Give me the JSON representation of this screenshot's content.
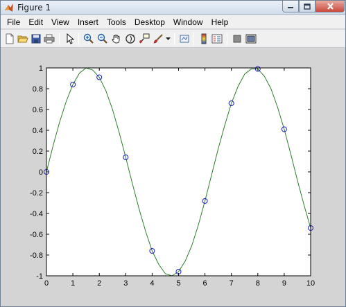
{
  "window": {
    "title": "Figure 1"
  },
  "menu": {
    "items": [
      "File",
      "Edit",
      "View",
      "Insert",
      "Tools",
      "Desktop",
      "Window",
      "Help"
    ]
  },
  "toolbar": {
    "buttons": [
      {
        "name": "new-figure-button",
        "icon": "new-file-icon"
      },
      {
        "name": "open-file-button",
        "icon": "folder-open-icon"
      },
      {
        "name": "save-figure-button",
        "icon": "floppy-disk-icon"
      },
      {
        "name": "print-figure-button",
        "icon": "printer-icon"
      },
      {
        "name": "edit-plot-button",
        "icon": "arrow-pointer-icon"
      },
      {
        "name": "zoom-in-button",
        "icon": "zoom-in-icon"
      },
      {
        "name": "zoom-out-button",
        "icon": "zoom-out-icon"
      },
      {
        "name": "pan-button",
        "icon": "hand-icon"
      },
      {
        "name": "rotate-3d-button",
        "icon": "rotate-3d-icon"
      },
      {
        "name": "data-cursor-button",
        "icon": "data-cursor-icon"
      },
      {
        "name": "brush-button",
        "icon": "brush-icon"
      },
      {
        "name": "link-plot-button",
        "icon": "link-plot-icon"
      },
      {
        "name": "insert-colorbar-button",
        "icon": "colorbar-icon"
      },
      {
        "name": "insert-legend-button",
        "icon": "legend-icon"
      },
      {
        "name": "hide-plot-tools-button",
        "icon": "hide-plot-tools-icon"
      },
      {
        "name": "show-plot-tools-button",
        "icon": "show-plot-tools-icon"
      }
    ]
  },
  "chart_data": {
    "type": "line",
    "title": "",
    "xlabel": "",
    "ylabel": "",
    "xlim": [
      0,
      10
    ],
    "ylim": [
      -1,
      1
    ],
    "grid": false,
    "x_ticks": [
      0,
      1,
      2,
      3,
      4,
      5,
      6,
      7,
      8,
      9,
      10
    ],
    "y_ticks": [
      -1,
      -0.8,
      -0.6,
      -0.4,
      -0.2,
      0,
      0.2,
      0.4,
      0.6,
      0.8,
      1
    ],
    "series": [
      {
        "style": "markers",
        "marker": "circle",
        "color": "#1f1fbf",
        "x": [
          0,
          1,
          2,
          3,
          4,
          5,
          6,
          7,
          8,
          9,
          10
        ],
        "y": [
          0,
          0.84,
          0.91,
          0.14,
          -0.76,
          -0.96,
          -0.28,
          0.66,
          0.99,
          0.41,
          -0.54
        ]
      },
      {
        "style": "line",
        "color": "#2f7d2f",
        "x": [
          0,
          0.25,
          0.5,
          0.75,
          1,
          1.25,
          1.5,
          1.75,
          2,
          2.25,
          2.5,
          2.75,
          3,
          3.25,
          3.5,
          3.75,
          4,
          4.25,
          4.5,
          4.75,
          5,
          5.25,
          5.5,
          5.75,
          6,
          6.25,
          6.5,
          6.75,
          7,
          7.25,
          7.5,
          7.75,
          8,
          8.25,
          8.5,
          8.75,
          9,
          9.25,
          9.5,
          9.75,
          10
        ],
        "y": [
          0,
          0.25,
          0.48,
          0.68,
          0.84,
          0.95,
          1.0,
          0.98,
          0.91,
          0.78,
          0.6,
          0.38,
          0.14,
          -0.11,
          -0.35,
          -0.57,
          -0.76,
          -0.89,
          -0.98,
          -1.0,
          -0.96,
          -0.86,
          -0.71,
          -0.51,
          -0.28,
          -0.03,
          0.22,
          0.45,
          0.66,
          0.82,
          0.94,
          0.99,
          0.99,
          0.92,
          0.8,
          0.62,
          0.41,
          0.17,
          -0.08,
          -0.32,
          -0.54
        ]
      }
    ]
  }
}
